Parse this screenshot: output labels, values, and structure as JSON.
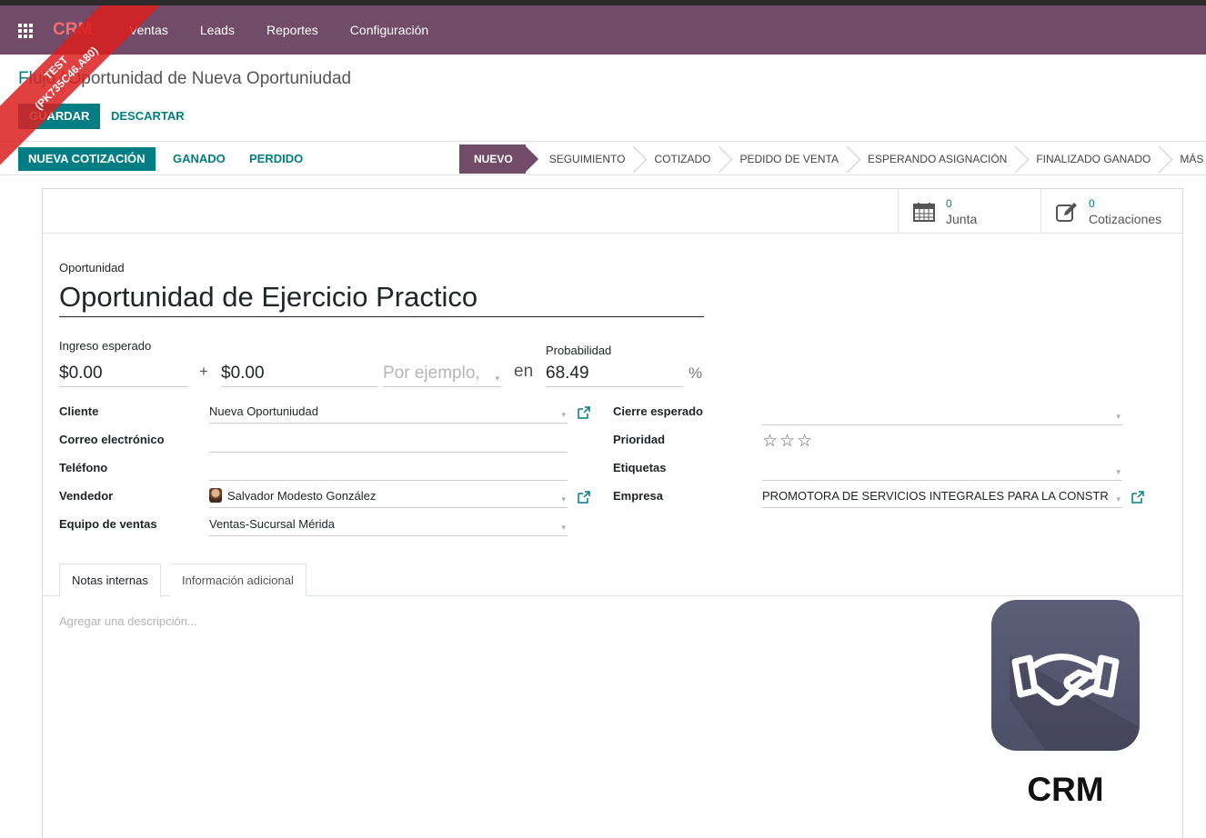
{
  "navbar": {
    "brand": "CRM",
    "menu": [
      "Ventas",
      "Leads",
      "Reportes",
      "Configuración"
    ]
  },
  "ribbon": {
    "line1": "TEST",
    "line2": "(PK735C46.A80)"
  },
  "breadcrumb": {
    "parent": "Flujo",
    "separator": "/",
    "current": "Oportunidad de Nueva Oportuniudad"
  },
  "actions": {
    "save": "GUARDAR",
    "discard": "DESCARTAR"
  },
  "header_buttons": {
    "new_quotation": "NUEVA COTIZACIÓN",
    "won": "GANADO",
    "lost": "PERDIDO"
  },
  "stages": [
    {
      "label": "NUEVO",
      "active": true
    },
    {
      "label": "SEGUIMIENTO",
      "active": false
    },
    {
      "label": "COTIZADO",
      "active": false
    },
    {
      "label": "PEDIDO DE VENTA",
      "active": false
    },
    {
      "label": "ESPERANDO ASIGNACIÓN",
      "active": false
    },
    {
      "label": "FINALIZADO GANADO",
      "active": false
    },
    {
      "label": "MÁS",
      "active": false
    }
  ],
  "smart_buttons": {
    "meetings": {
      "count": "0",
      "label": "Junta"
    },
    "quotations": {
      "count": "0",
      "label": "Cotizaciones"
    }
  },
  "form": {
    "opportunity_label": "Oportunidad",
    "opportunity_name": "Oportunidad de Ejercicio Practico",
    "expected_revenue_label": "Ingreso esperado",
    "expected_revenue": "$0.00",
    "plus": "+",
    "recurring_revenue": "$0.00",
    "recurring_plan_placeholder": "Por ejemplo,",
    "en": "en",
    "probability_label": "Probabilidad",
    "probability": "68.49",
    "percent_sign": "%",
    "left_fields": {
      "customer_label": "Cliente",
      "customer_value": "Nueva Oportuniudad",
      "email_label": "Correo electrónico",
      "email_value": "",
      "phone_label": "Teléfono",
      "phone_value": "",
      "salesperson_label": "Vendedor",
      "salesperson_value": "Salvador Modesto González",
      "team_label": "Equipo de ventas",
      "team_value": "Ventas-Sucursal Mérida"
    },
    "right_fields": {
      "deadline_label": "Cierre esperado",
      "deadline_value": "",
      "priority_label": "Prioridad",
      "priority_stars": "☆☆☆",
      "priority_value": 0,
      "tags_label": "Etiquetas",
      "tags_value": "",
      "company_label": "Empresa",
      "company_value": "PROMOTORA DE SERVICIOS INTEGRALES PARA LA CONSTR"
    }
  },
  "tabs": [
    "Notas internas",
    "Información adicional"
  ],
  "notes_placeholder": "Agregar una descripción...",
  "logo": {
    "caption": "CRM",
    "icon": "handshake-icon"
  },
  "colors": {
    "navbar": "#714b67",
    "primary": "#017e84",
    "logo_bg": "#5c5d77",
    "ribbon": "#dc1e1e"
  }
}
